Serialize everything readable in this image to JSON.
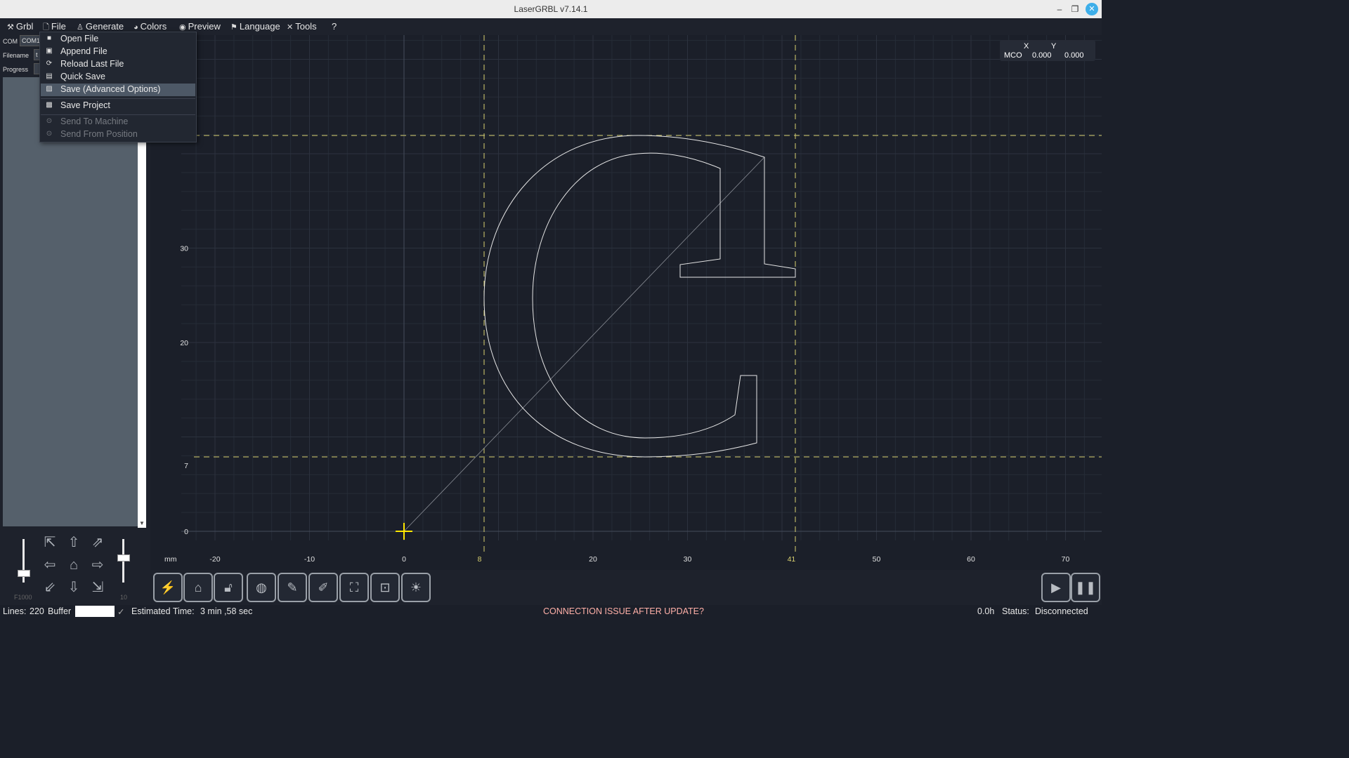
{
  "window": {
    "title": "LaserGRBL v7.14.1",
    "minimize": "–",
    "restore": "❐",
    "close": "✕"
  },
  "menu": [
    {
      "label": "Grbl",
      "icon": "⚒"
    },
    {
      "label": "File",
      "icon": "🗋"
    },
    {
      "label": "Generate",
      "icon": "♙"
    },
    {
      "label": "Colors",
      "icon": "◕"
    },
    {
      "label": "Preview",
      "icon": "◉"
    },
    {
      "label": "Language",
      "icon": "⚑"
    },
    {
      "label": "Tools",
      "icon": "✕"
    },
    {
      "label": "?",
      "icon": ""
    }
  ],
  "file_menu": {
    "items": [
      {
        "label": "Open File",
        "icon": "folder-icon",
        "enabled": true
      },
      {
        "label": "Append File",
        "icon": "append-file-icon",
        "enabled": true
      },
      {
        "label": "Reload Last File",
        "icon": "reload-icon",
        "enabled": true
      },
      {
        "label": "Quick Save",
        "icon": "save-icon",
        "enabled": true
      },
      {
        "label": "Save (Advanced Options)",
        "icon": "save-advanced-icon",
        "enabled": true,
        "highlighted": true
      },
      {
        "label": "Save Project",
        "icon": "save-project-icon",
        "enabled": true
      },
      {
        "label": "Send To Machine",
        "icon": "play-circle-icon",
        "enabled": false
      },
      {
        "label": "Send From Position",
        "icon": "play-circle-icon",
        "enabled": false
      }
    ]
  },
  "left_panel": {
    "com_label": "COM",
    "com_value": "COM1",
    "filename_label": "Filename",
    "filename_value": "t",
    "progress_label": "Progress",
    "speed_label": "F1000",
    "step_label": "10"
  },
  "coords": {
    "mode": "MCO",
    "x_label": "X",
    "y_label": "Y",
    "x_value": "0.000",
    "y_value": "0.000"
  },
  "canvas": {
    "unit_label": "mm",
    "x_ticks": [
      "-20",
      "-10",
      "0",
      "8",
      "20",
      "30",
      "41",
      "50",
      "60",
      "70"
    ],
    "y_ticks": [
      "30",
      "20",
      "7",
      "0"
    ],
    "bounds": {
      "x_min": "8",
      "x_max": "41",
      "y_min": "7"
    },
    "colors": {
      "background": "#1b1f29",
      "grid": "#2a303c",
      "bounds": "#d8d070",
      "path": "#e6e6e6",
      "origin": "#ffe800"
    }
  },
  "toolbar": {
    "buttons": [
      "lightning-icon",
      "home-icon",
      "unlock-icon",
      "globe-icon",
      "pen-rotate-icon",
      "pen-icon",
      "frame-icon",
      "focus-icon",
      "lightbulb-icon"
    ],
    "run": "play-icon",
    "pause": "pause-icon"
  },
  "status": {
    "lines_label": "Lines:",
    "lines_value": "220",
    "buffer_label": "Buffer",
    "estimated_label": "Estimated Time:",
    "estimated_value": "3 min ,58 sec",
    "notice": "CONNECTION ISSUE AFTER UPDATE?",
    "notice_color": "#ffb0a8",
    "elapsed": "0.0h",
    "status_label": "Status:",
    "status_value": "Disconnected"
  }
}
